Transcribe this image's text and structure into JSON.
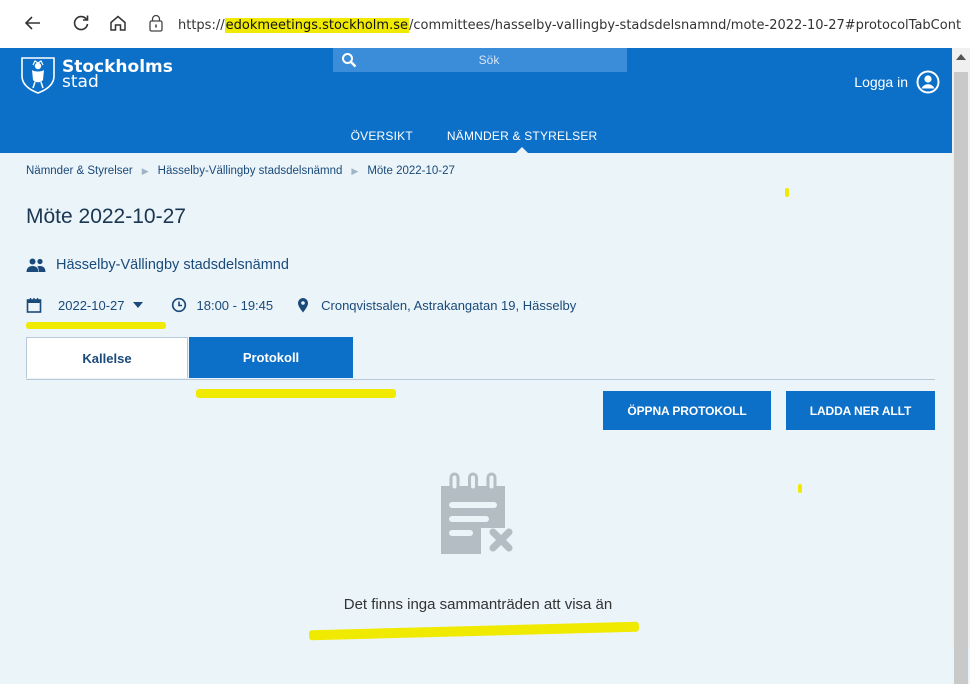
{
  "browser": {
    "url_scheme": "https://",
    "url_host": "edokmeetings.stockholm.se",
    "url_path": "/committees/hasselby-vallingby-stadsdelsnamnd/mote-2022-10-27#protocolTabCont"
  },
  "header": {
    "logo_line1": "Stockholms",
    "logo_line2": "stad",
    "search_placeholder": "Sök",
    "login_label": "Logga in",
    "nav": [
      {
        "label": "ÖVERSIKT"
      },
      {
        "label": "NÄMNDER & STYRELSER"
      }
    ]
  },
  "breadcrumb": [
    "Nämnder & Styrelser",
    "Hässelby-Vällingby stadsdelsnämnd",
    "Möte 2022-10-27"
  ],
  "meeting": {
    "title": "Möte 2022-10-27",
    "committee": "Hässelby-Vällingby stadsdelsnämnd",
    "date": "2022-10-27",
    "time": "18:00 - 19:45",
    "location": "Cronqvistsalen, Astrakangatan 19, Hässelby"
  },
  "tabs": [
    {
      "label": "Kallelse"
    },
    {
      "label": "Protokoll"
    }
  ],
  "actions": {
    "open_label": "ÖPPNA PROTOKOLL",
    "download_label": "LADDA NER ALLT"
  },
  "empty_state": {
    "message": "Det finns inga sammanträden att visa än"
  },
  "colors": {
    "brand": "#0c6fc8",
    "background": "#ebf4f9",
    "highlight": "#f0ea00"
  }
}
